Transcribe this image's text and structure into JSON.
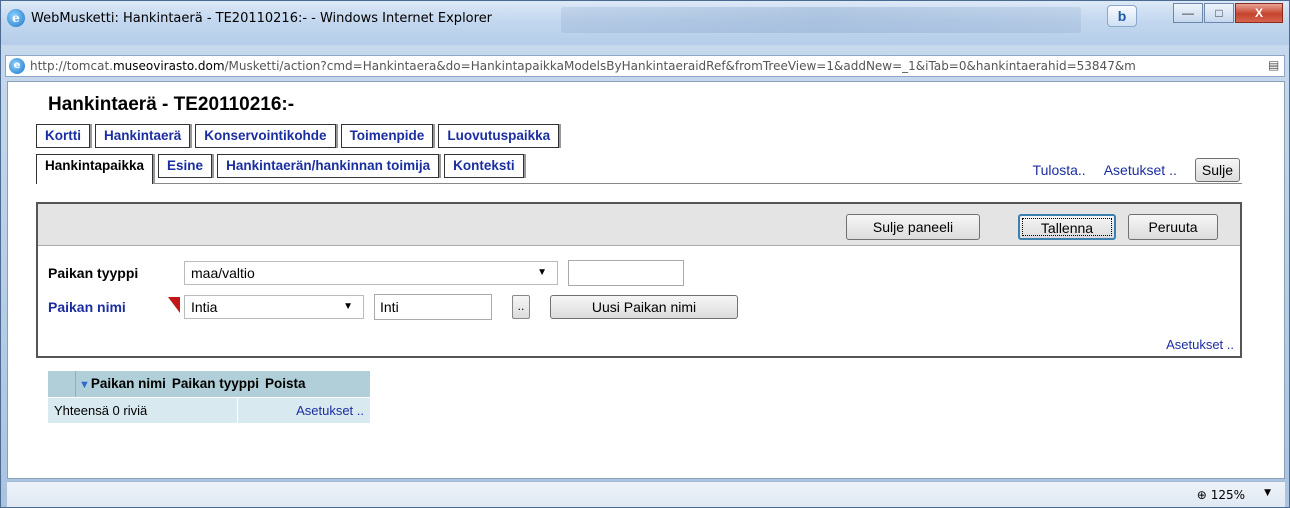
{
  "window": {
    "title": "WebMusketti: Hankintaerä - TE20110216:- - Windows Internet Explorer",
    "controls": {
      "minimize": "—",
      "maximize": "□",
      "close": "X",
      "bing": "b"
    }
  },
  "address": {
    "prefix": "http://tomcat.",
    "host": "museovirasto.dom",
    "path": "/Musketti/action?cmd=Hankintaera&do=HankintapaikkaModelsByHankintaeraidRef&fromTreeView=1&addNew=_1&iTab=0&hankintaerahid=53847&m"
  },
  "page": {
    "title": "Hankintaerä  - TE20110216:-"
  },
  "tabs_row1": [
    {
      "label": "Kortti"
    },
    {
      "label": "Hankintaerä"
    },
    {
      "label": "Konservointikohde"
    },
    {
      "label": "Toimenpide"
    },
    {
      "label": "Luovutuspaikka"
    }
  ],
  "tabs_row2": [
    {
      "label": "Hankintapaikka"
    },
    {
      "label": "Esine"
    },
    {
      "label": "Hankintaerän/hankinnan toimija"
    },
    {
      "label": "Konteksti"
    }
  ],
  "top_links": {
    "print": "Tulosta..",
    "settings": "Asetukset ..",
    "close": "Sulje"
  },
  "panel": {
    "close_panel": "Sulje paneeli",
    "save": "Tallenna",
    "cancel": "Peruuta",
    "place_type_label": "Paikan tyyppi",
    "place_type_value": "maa/valtio",
    "place_name_label": "Paikan nimi",
    "place_name_value": "Intia",
    "place_name_input": "Inti",
    "browse": "..",
    "new_place_name": "Uusi Paikan nimi",
    "settings": "Asetukset .."
  },
  "grid": {
    "columns": [
      "Paikan nimi",
      "Paikan tyyppi",
      "Poista"
    ],
    "footer_count": "Yhteensä 0 riviä",
    "footer_settings": "Asetukset .."
  },
  "status": {
    "zoom": "125%"
  }
}
